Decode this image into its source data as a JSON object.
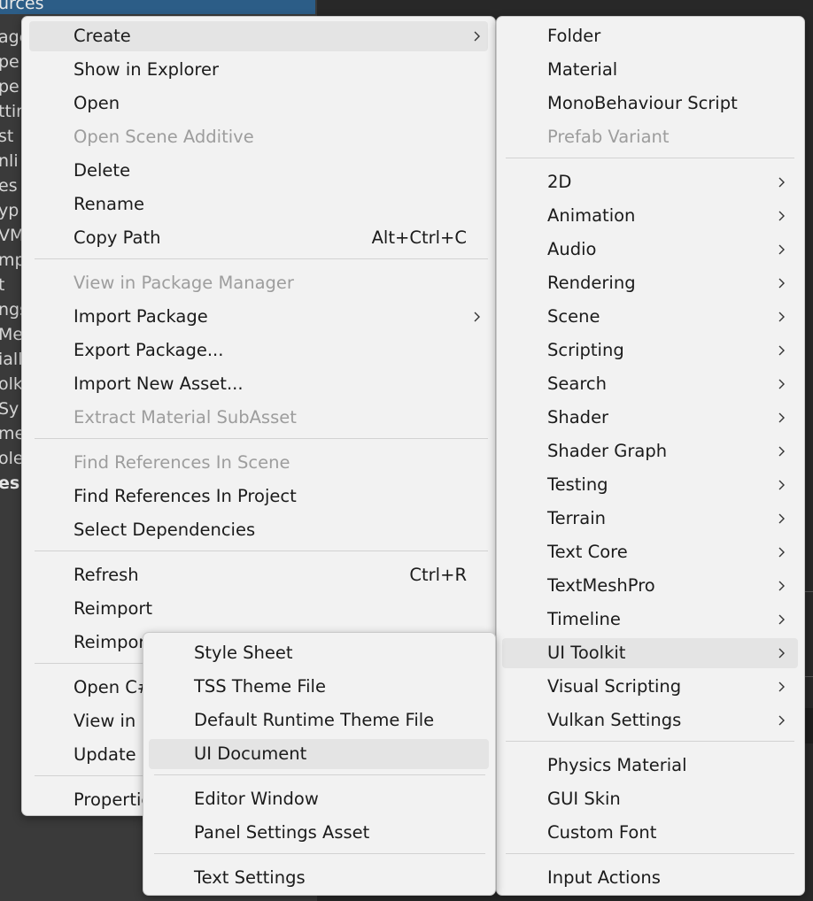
{
  "background": {
    "selected_row_text": "urces",
    "rows": [
      "age",
      "pe",
      "pe",
      "ttin",
      "st",
      "nli",
      "es",
      "yp",
      "VM",
      "mp",
      "t",
      "ngs",
      "Mes",
      "iall",
      "olk",
      "Sy",
      "me",
      "ole",
      "es"
    ]
  },
  "main_menu": {
    "items": [
      {
        "label": "Create"
      },
      {
        "label": "Show in Explorer"
      },
      {
        "label": "Open"
      },
      {
        "label": "Open Scene Additive"
      },
      {
        "label": "Delete"
      },
      {
        "label": "Rename"
      },
      {
        "label": "Copy Path",
        "shortcut": "Alt+Ctrl+C"
      },
      {
        "label": "View in Package Manager"
      },
      {
        "label": "Import Package"
      },
      {
        "label": "Export Package..."
      },
      {
        "label": "Import New Asset..."
      },
      {
        "label": "Extract Material SubAsset"
      },
      {
        "label": "Find References In Scene"
      },
      {
        "label": "Find References In Project"
      },
      {
        "label": "Select Dependencies"
      },
      {
        "label": "Refresh",
        "shortcut": "Ctrl+R"
      },
      {
        "label": "Reimport"
      },
      {
        "label": "Reimpor"
      },
      {
        "label": "Open C#"
      },
      {
        "label": "View in I"
      },
      {
        "label": "Update"
      },
      {
        "label": "Propertie"
      }
    ]
  },
  "create_menu": {
    "items": [
      {
        "label": "Folder"
      },
      {
        "label": "Material"
      },
      {
        "label": "MonoBehaviour Script"
      },
      {
        "label": "Prefab Variant"
      },
      {
        "label": "2D"
      },
      {
        "label": "Animation"
      },
      {
        "label": "Audio"
      },
      {
        "label": "Rendering"
      },
      {
        "label": "Scene"
      },
      {
        "label": "Scripting"
      },
      {
        "label": "Search"
      },
      {
        "label": "Shader"
      },
      {
        "label": "Shader Graph"
      },
      {
        "label": "Testing"
      },
      {
        "label": "Terrain"
      },
      {
        "label": "Text Core"
      },
      {
        "label": "TextMeshPro"
      },
      {
        "label": "Timeline"
      },
      {
        "label": "UI Toolkit"
      },
      {
        "label": "Visual Scripting"
      },
      {
        "label": "Vulkan Settings"
      },
      {
        "label": "Physics Material"
      },
      {
        "label": "GUI Skin"
      },
      {
        "label": "Custom Font"
      },
      {
        "label": "Input Actions"
      }
    ]
  },
  "ui_toolkit_menu": {
    "items": [
      {
        "label": "Style Sheet"
      },
      {
        "label": "TSS Theme File"
      },
      {
        "label": "Default Runtime Theme File"
      },
      {
        "label": "UI Document"
      },
      {
        "label": "Editor Window"
      },
      {
        "label": "Panel Settings Asset"
      },
      {
        "label": "Text Settings"
      }
    ]
  },
  "colors": {
    "menu_background": "#f2f2f2",
    "highlight": "#e4e4e4",
    "disabled_text": "#9d9d9d",
    "selection_blue": "#2c5d87"
  }
}
